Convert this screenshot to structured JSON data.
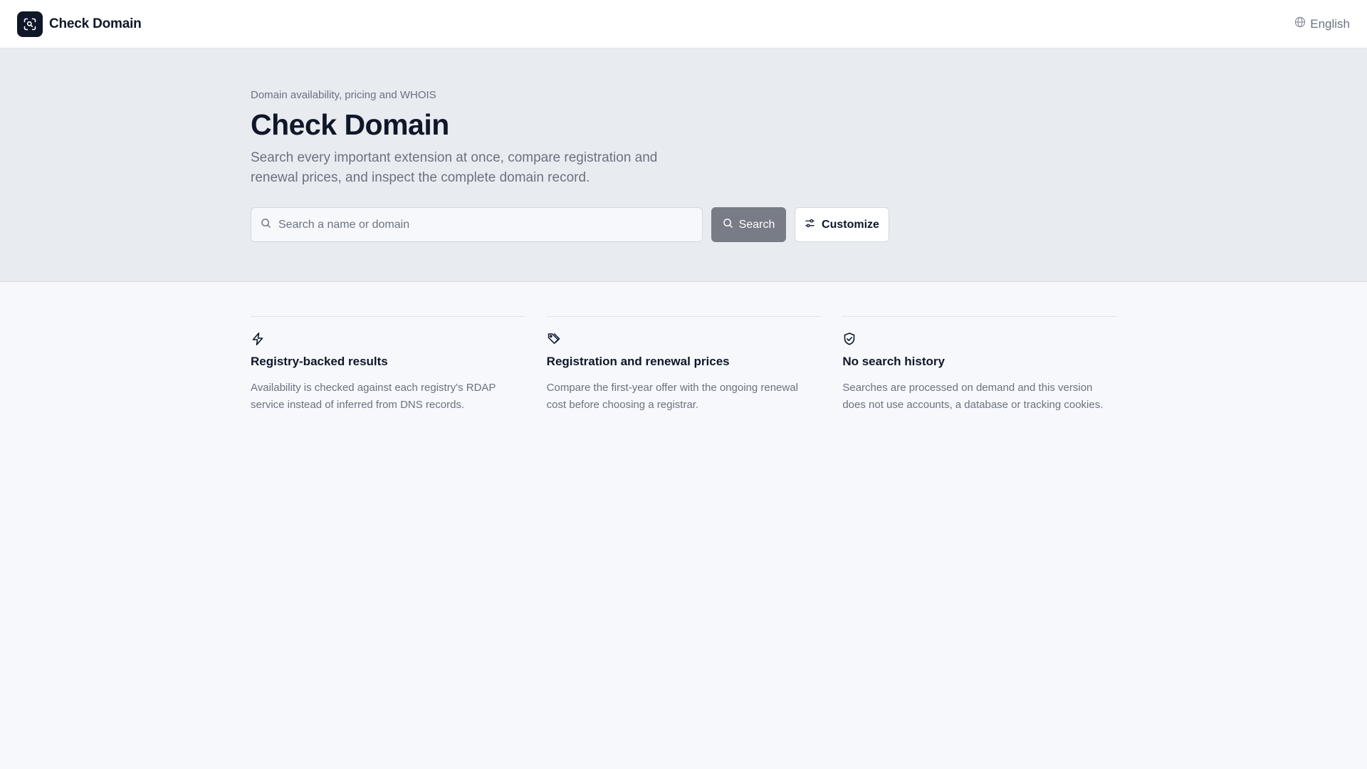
{
  "header": {
    "brand_name": "Check Domain",
    "language_label": "English",
    "logo_icon": "domain-scan-icon",
    "language_icon": "globe-icon"
  },
  "hero": {
    "eyebrow": "Domain availability, pricing and WHOIS",
    "title": "Check Domain",
    "subtitle": "Search every important extension at once, compare registration and renewal prices, and inspect the complete domain record."
  },
  "search": {
    "placeholder": "Search a name or domain",
    "value": "",
    "search_button_label": "Search",
    "customize_button_label": "Customize"
  },
  "features": [
    {
      "icon": "lightning-icon",
      "title": "Registry-backed results",
      "description": "Availability is checked against each registry's RDAP service instead of inferred from DNS records."
    },
    {
      "icon": "price-tag-icon",
      "title": "Registration and renewal prices",
      "description": "Compare the first-year offer with the ongoing renewal cost before choosing a registrar."
    },
    {
      "icon": "shield-check-icon",
      "title": "No search history",
      "description": "Searches are processed on demand and this version does not use accounts, a database or tracking cookies."
    }
  ],
  "colors": {
    "brand_dark": "#0f1729",
    "hero_background": "#e8ebf0",
    "page_background": "#f6f8fb",
    "search_button": "#787c86",
    "muted_text": "#6b7280"
  }
}
